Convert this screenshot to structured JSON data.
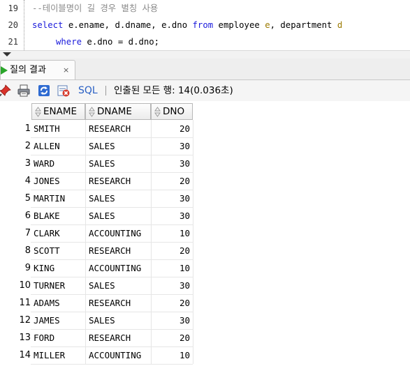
{
  "editor": {
    "lines": [
      {
        "number": "19",
        "comment": "--테이블명이 길 경우 별칭 사용"
      },
      {
        "number": "20",
        "kw_select": "select",
        "cols": " e.ename, d.dname, e.dno ",
        "kw_from": "from",
        "table1": " employee ",
        "alias1": "e",
        "sep": ", department ",
        "alias2": "d"
      },
      {
        "number": "21",
        "kw_where": "where",
        "condition": " e.dno = d.dno;"
      }
    ]
  },
  "result_tab": {
    "label": "질의 결과",
    "close": "×"
  },
  "toolbar": {
    "icons": [
      "pin-icon",
      "print-icon",
      "refresh-icon",
      "cancel-query-icon"
    ],
    "sql_label": "SQL",
    "separator": "|",
    "status": "인출된 모든 행: 14(0.036초)"
  },
  "grid": {
    "columns": [
      "ENAME",
      "DNAME",
      "DNO"
    ],
    "rows": [
      {
        "n": "1",
        "ename": "SMITH",
        "dname": "RESEARCH",
        "dno": "20"
      },
      {
        "n": "2",
        "ename": "ALLEN",
        "dname": "SALES",
        "dno": "30"
      },
      {
        "n": "3",
        "ename": "WARD",
        "dname": "SALES",
        "dno": "30"
      },
      {
        "n": "4",
        "ename": "JONES",
        "dname": "RESEARCH",
        "dno": "20"
      },
      {
        "n": "5",
        "ename": "MARTIN",
        "dname": "SALES",
        "dno": "30"
      },
      {
        "n": "6",
        "ename": "BLAKE",
        "dname": "SALES",
        "dno": "30"
      },
      {
        "n": "7",
        "ename": "CLARK",
        "dname": "ACCOUNTING",
        "dno": "10"
      },
      {
        "n": "8",
        "ename": "SCOTT",
        "dname": "RESEARCH",
        "dno": "20"
      },
      {
        "n": "9",
        "ename": "KING",
        "dname": "ACCOUNTING",
        "dno": "10"
      },
      {
        "n": "10",
        "ename": "TURNER",
        "dname": "SALES",
        "dno": "30"
      },
      {
        "n": "11",
        "ename": "ADAMS",
        "dname": "RESEARCH",
        "dno": "20"
      },
      {
        "n": "12",
        "ename": "JAMES",
        "dname": "SALES",
        "dno": "30"
      },
      {
        "n": "13",
        "ename": "FORD",
        "dname": "RESEARCH",
        "dno": "20"
      },
      {
        "n": "14",
        "ename": "MILLER",
        "dname": "ACCOUNTING",
        "dno": "10"
      }
    ]
  },
  "colors": {
    "keyword": "#1a1adb",
    "comment": "#8a8a8a",
    "alias": "#9b7a00",
    "sql_link": "#2a60c4",
    "tab_play": "#2aa52a"
  }
}
